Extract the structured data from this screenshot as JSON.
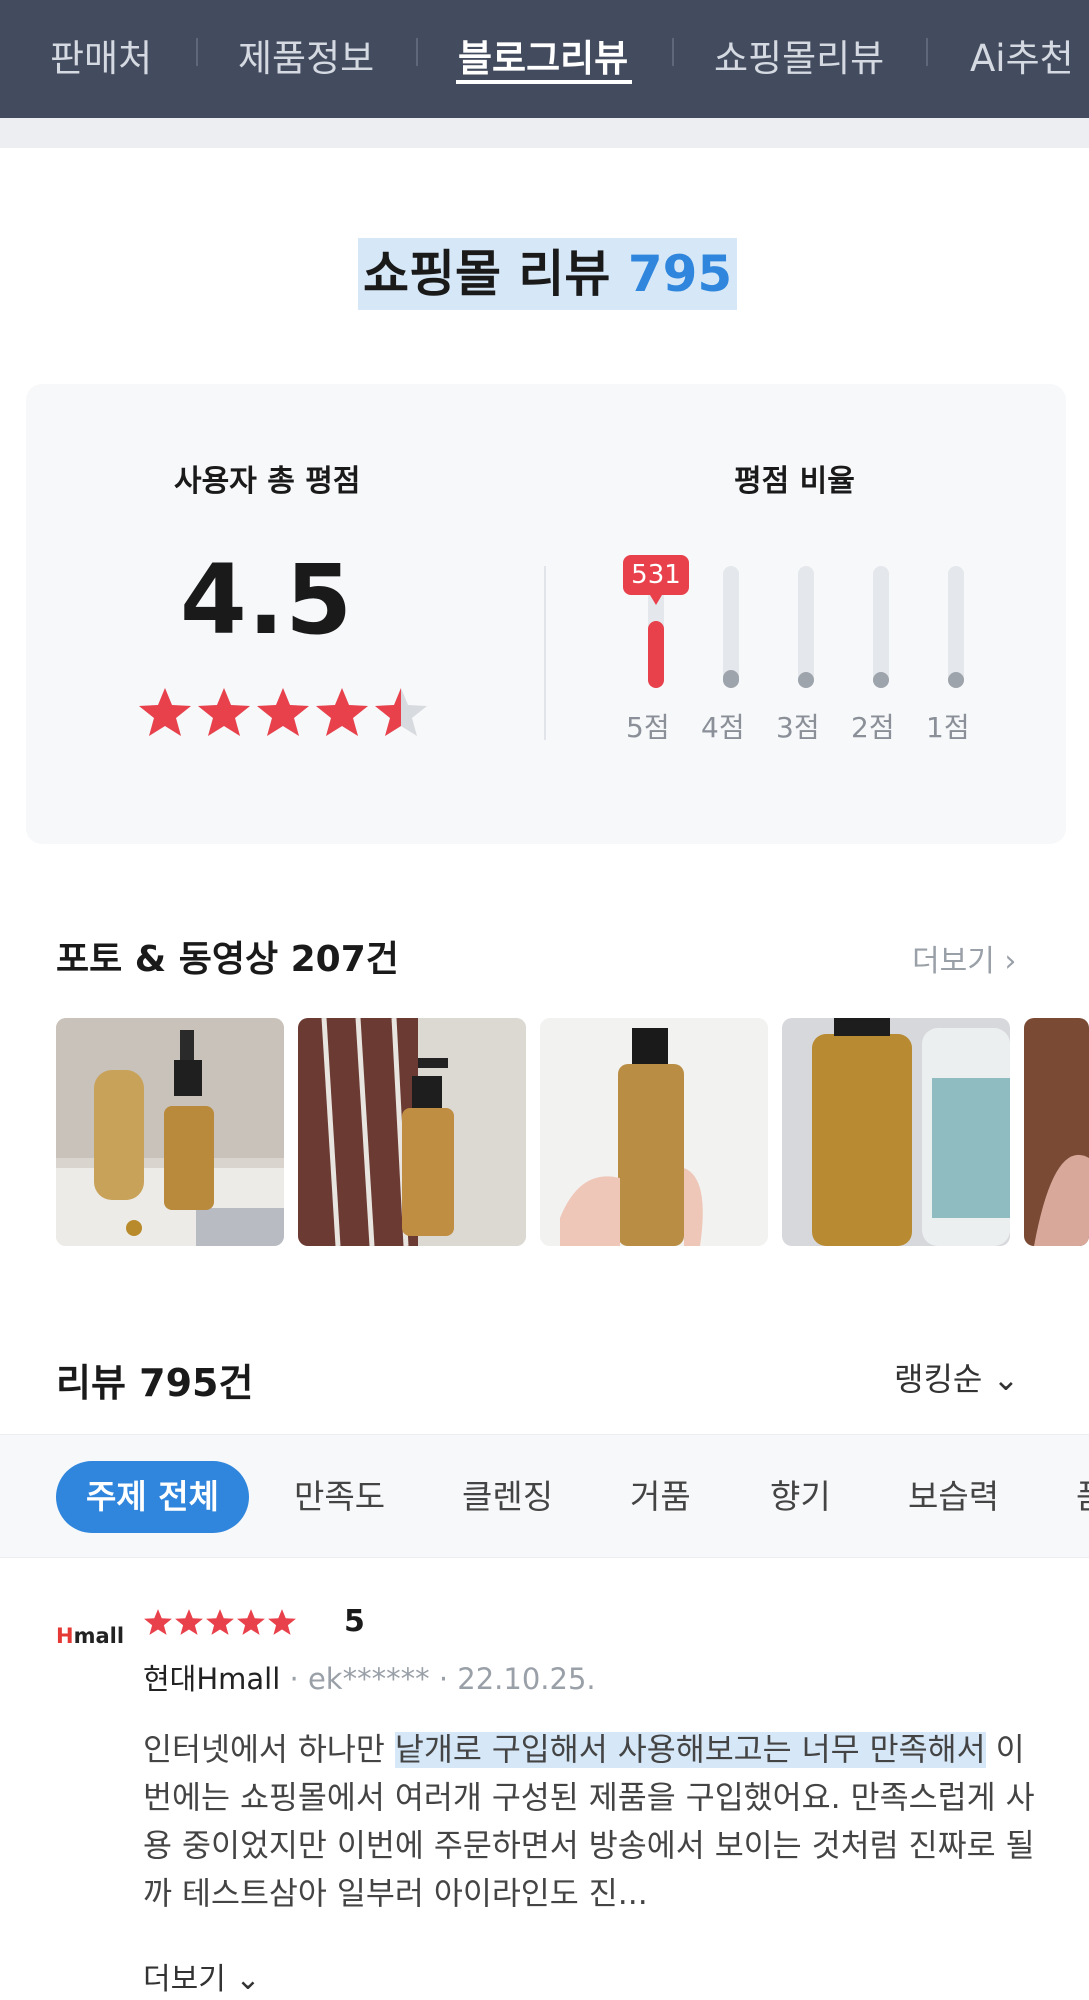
{
  "nav": {
    "tabs": [
      "판매처",
      "제품정보",
      "블로그리뷰",
      "쇼핑몰리뷰",
      "Ai추천"
    ],
    "active_tab": "블로그리뷰"
  },
  "section": {
    "title": "쇼핑몰 리뷰",
    "count": "795"
  },
  "rating": {
    "avg_heading": "사용자 총 평점",
    "avg_score": "4.5",
    "avg_value": 4.5,
    "ratio_heading": "평점 비율",
    "bars": [
      {
        "label": "5점",
        "level": 0.55,
        "color": "#e8414b"
      },
      {
        "label": "4점",
        "level": 0.15,
        "color": "#9ea4ac"
      },
      {
        "label": "3점",
        "level": 0.06,
        "color": "#9ea4ac"
      },
      {
        "label": "2점",
        "level": 0.06,
        "color": "#9ea4ac"
      },
      {
        "label": "1점",
        "level": 0.06,
        "color": "#9ea4ac"
      }
    ],
    "top_badge": "531"
  },
  "photos": {
    "title": "포토 & 동영상 207건",
    "more": "더보기 ›"
  },
  "reviews": {
    "title": "리뷰 795건",
    "sort": "랭킹순 ⌄",
    "topics": [
      "주제 전체",
      "만족도",
      "클렌징",
      "거품",
      "향기",
      "보습력",
      "품"
    ],
    "item": {
      "logo_h": "H",
      "logo_rest": "mall",
      "score": "5",
      "stars": 5,
      "mall": "현대Hmall",
      "user": "ek******",
      "date": "22.10.25.",
      "text_1": "인터넷에서 하나만 ",
      "text_highlight": "낱개로 구입해서 사용해보고는 너무 만족해서",
      "text_2": " 이번에는 쇼핑몰에서 여러개 구성된 제품을 구입했어요. 만족스럽게 사용 중이었지만  이번에 주문하면서 방송에서 보이는 것처럼 진짜로 될까 테스트삼아 일부러 아이라인도 진...",
      "more": "더보기 ⌄"
    }
  },
  "colors": {
    "accent": "#2f86dc",
    "star_red": "#e8414b",
    "nav_bg": "#434c5f"
  }
}
